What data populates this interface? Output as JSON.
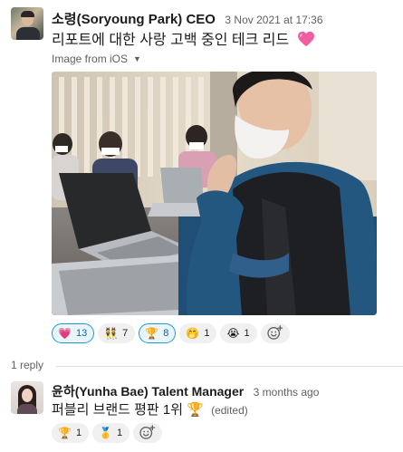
{
  "message": {
    "author": "소령(Soryoung Park) CEO",
    "timestamp": "3 Nov 2021 at 17:36",
    "text": "리포트에 대한 사랑 고백 중인 테크 리드",
    "text_emoji": "heart-icon",
    "image_label": "Image from iOS",
    "reactions": [
      {
        "emoji": "💗",
        "icon": "pink-heart-icon",
        "count": "13",
        "mine": true
      },
      {
        "emoji": "👯",
        "icon": "people-dancing-icon",
        "count": "7",
        "mine": false
      },
      {
        "emoji": "🏆",
        "icon": "trophy-icon",
        "count": "8",
        "mine": true
      },
      {
        "emoji": "🤭",
        "icon": "giggle-face-icon",
        "count": "1",
        "mine": false
      },
      {
        "emoji": "😭",
        "icon": "crying-face-icon",
        "count": "1",
        "mine": false
      }
    ]
  },
  "thread": {
    "reply_count": "1 reply"
  },
  "reply": {
    "author": "윤하(Yunha Bae) Talent Manager",
    "timestamp": "3 months ago",
    "text": "퍼블리 브랜드 평판 1위",
    "text_emoji": "🏆",
    "edited": "(edited)",
    "reactions": [
      {
        "emoji": "🏆",
        "icon": "trophy-icon",
        "count": "1"
      },
      {
        "emoji": "🥇",
        "icon": "gold-medal-icon",
        "count": "1"
      }
    ]
  },
  "colors": {
    "link_blue": "#1264a3",
    "reaction_bg": "#f0f0f0",
    "reaction_selected_bg": "#e8f5fa",
    "reaction_selected_border": "#1d9bd1",
    "muted_text": "#616061"
  }
}
